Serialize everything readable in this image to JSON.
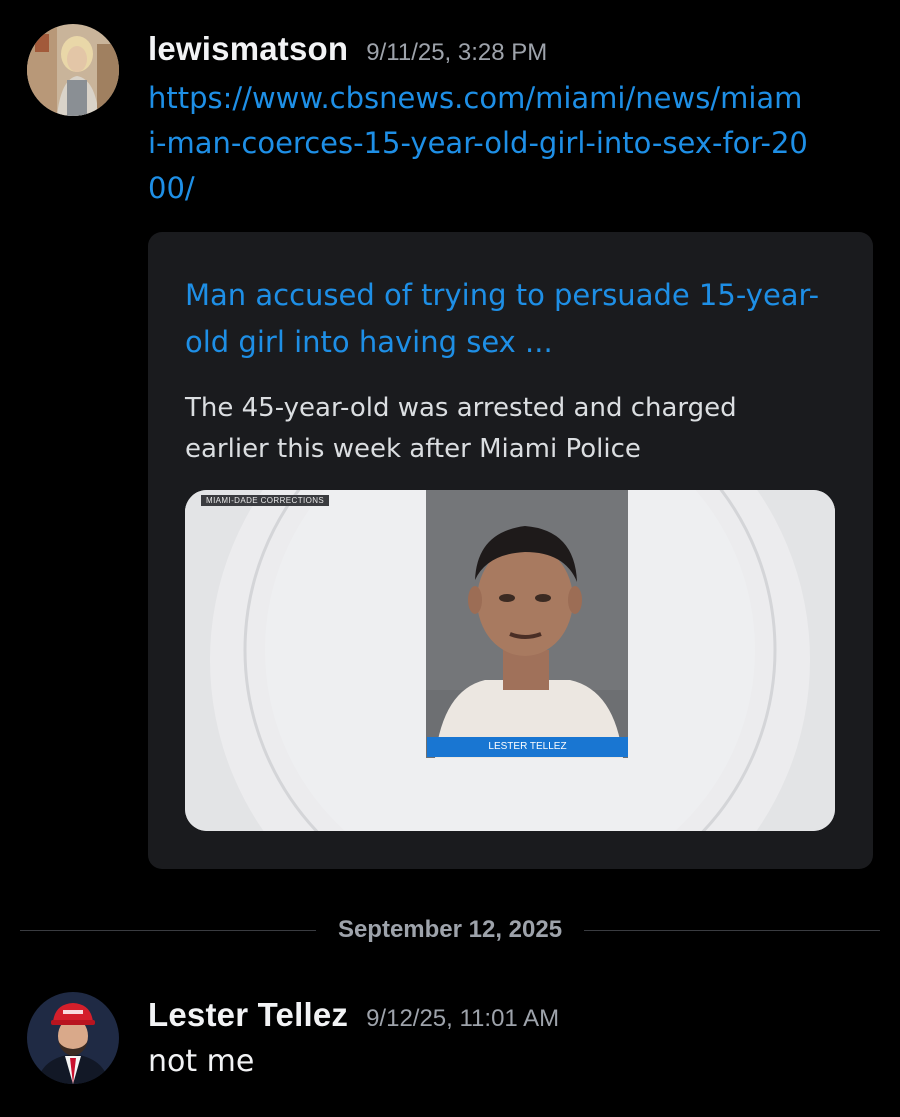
{
  "messages": [
    {
      "username": "lewismatson",
      "timestamp": "9/11/25, 3:28 PM",
      "link": "https://www.cbsnews.com/miami/news/miami-man-coerces-15-year-old-girl-into-sex-for-2000/",
      "embed": {
        "title": "Man accused of trying to persuade 15-year-old girl into having sex ...",
        "description": "The 45-year-old was arrested and charged earlier this week after Miami Police",
        "image_tag": "MIAMI-DADE CORRECTIONS",
        "image_caption": "LESTER TELLEZ"
      }
    },
    {
      "username": "Lester Tellez",
      "timestamp": "9/12/25, 11:01 AM",
      "text": "not me"
    }
  ],
  "date_divider": "September 12, 2025",
  "colors": {
    "background": "#000000",
    "link": "#1e8fe6",
    "embed_bg": "#1a1b1e",
    "muted": "#9ea3ab"
  }
}
